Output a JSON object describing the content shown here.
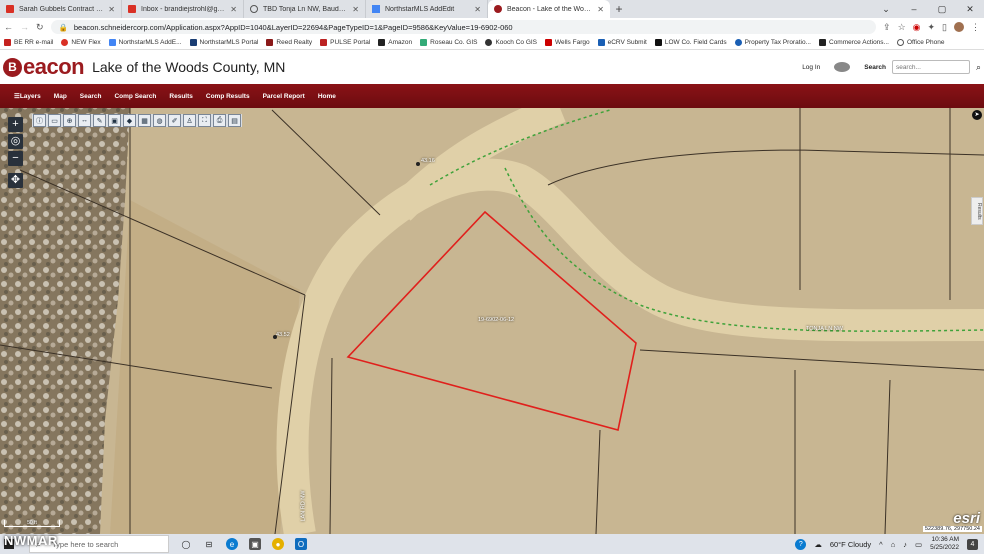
{
  "tabs": [
    {
      "label": "Sarah Gubbels Contract questio",
      "icon": "gmail-icon",
      "active": false
    },
    {
      "label": "Inbox - brandiejstrohl@gmail.co",
      "icon": "gmail-icon",
      "active": false
    },
    {
      "label": "TBD Tonja Ln NW, Baudette, MN",
      "icon": "globe-icon",
      "active": false
    },
    {
      "label": "NorthstarMLS AddEdit",
      "icon": "northstar-icon",
      "active": false
    },
    {
      "label": "Beacon - Lake of the Woods Co",
      "icon": "beacon-icon",
      "active": true
    }
  ],
  "new_tab": "+",
  "window_controls": [
    "⌄",
    "–",
    "▢",
    "✕"
  ],
  "url": "beacon.schneidercorp.com/Application.aspx?AppID=1040&LayerID=22694&PageTypeID=1&PageID=9586&KeyValue=19-6902-060",
  "bookmarks": [
    {
      "label": "BE RR e-mail",
      "color": "#c5221f"
    },
    {
      "label": "NEW Flex",
      "color": "#d93025"
    },
    {
      "label": "NorthstarMLS AddE...",
      "color": "#4285f4"
    },
    {
      "label": "NorthstarMLS Portal",
      "color": "#1a3d73"
    },
    {
      "label": "Reed Realty",
      "color": "#8b1a1a"
    },
    {
      "label": "PULSE Portal",
      "color": "#b22"
    },
    {
      "label": "Amazon",
      "color": "#222"
    },
    {
      "label": "Roseau Co. GIS",
      "color": "#3a7"
    },
    {
      "label": "Kooch Co GIS",
      "color": "#333"
    },
    {
      "label": "Wells Fargo",
      "color": "#c00"
    },
    {
      "label": "eCRV Submit",
      "color": "#1a5fb4"
    },
    {
      "label": "LOW Co. Field Cards",
      "color": "#111"
    },
    {
      "label": "Property Tax Proratio...",
      "color": "#1a5fb4"
    },
    {
      "label": "Commerce Actions...",
      "color": "#222"
    },
    {
      "label": "Office Phone",
      "color": "#555"
    }
  ],
  "beacon": {
    "logo_mark": "B",
    "logo_text": "eacon",
    "county": "Lake of the Woods County, MN",
    "login": "Log In",
    "search_label": "Search",
    "search_placeholder": "search...",
    "nav": [
      "Layers",
      "Map",
      "Search",
      "Comp Search",
      "Results",
      "Comp Results",
      "Parcel Report",
      "Home"
    ]
  },
  "map": {
    "labels": {
      "parcel": "19-6902-06-12",
      "road": "TONJA LN NW",
      "road2": "LAN RD NW",
      "marker1": "43.16",
      "marker2": "43.52"
    },
    "results_tab": "Results",
    "scale": "50 ft",
    "esri": "esri",
    "coords": "522389.76, 297750.24"
  },
  "taskbar": {
    "search_placeholder": "Type here to search",
    "weather": "60°F Cloudy",
    "time": "10:36 AM",
    "date": "5/25/2022",
    "notifications": "4"
  },
  "watermark": "NWMAR"
}
